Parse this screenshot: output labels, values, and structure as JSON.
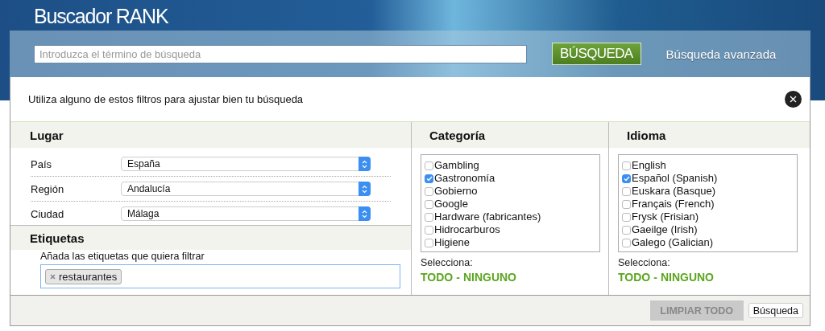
{
  "header": {
    "title": "Buscador RANK"
  },
  "search": {
    "placeholder": "Introduzca el término de búsqueda",
    "button": "BÚSQUEDA",
    "advanced_link": "Búsqueda avanzada"
  },
  "dialog": {
    "intro": "Utiliza alguno de estos filtros para ajustar bien tu búsqueda",
    "place": {
      "heading": "Lugar",
      "fields": [
        {
          "label": "País",
          "value": "España"
        },
        {
          "label": "Región",
          "value": "Andalucía"
        },
        {
          "label": "Ciudad",
          "value": "Málaga"
        }
      ]
    },
    "tags": {
      "heading": "Etiquetas",
      "hint": "Añada las etiquetas que quiera filtrar",
      "tags": [
        "restaurantes"
      ]
    },
    "category": {
      "heading": "Categoría",
      "items": [
        {
          "label": "Gambling",
          "checked": false
        },
        {
          "label": "Gastronomía",
          "checked": true
        },
        {
          "label": "Gobierno",
          "checked": false
        },
        {
          "label": "Google",
          "checked": false
        },
        {
          "label": "Hardware (fabricantes)",
          "checked": false
        },
        {
          "label": "Hidrocarburos",
          "checked": false
        },
        {
          "label": "Higiene",
          "checked": false
        }
      ],
      "select_label": "Selecciona:",
      "all_link": "TODO",
      "separator": "-",
      "none_link": "NINGUNO"
    },
    "language": {
      "heading": "Idioma",
      "items": [
        {
          "label": "English",
          "checked": false
        },
        {
          "label": "Español (Spanish)",
          "checked": true
        },
        {
          "label": "Euskara (Basque)",
          "checked": false
        },
        {
          "label": "Français (French)",
          "checked": false
        },
        {
          "label": "Frysk (Frisian)",
          "checked": false
        },
        {
          "label": "Gaeilge (Irish)",
          "checked": false
        },
        {
          "label": "Galego (Galician)",
          "checked": false
        }
      ],
      "select_label": "Selecciona:",
      "all_link": "TODO",
      "separator": "-",
      "none_link": "NINGUNO"
    },
    "buttons": {
      "clear": "LIMPIAR TODO",
      "search": "Búsqueda"
    }
  }
}
